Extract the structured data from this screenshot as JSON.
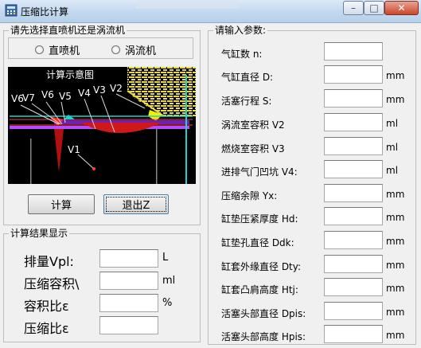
{
  "window": {
    "title": "压缩比计算"
  },
  "engine_type": {
    "group_label": "请先选择直喷机还是涡流机",
    "options": [
      "直喷机",
      "涡流机"
    ]
  },
  "diagram": {
    "title": "计算示意图",
    "labels": [
      "V6",
      "V7",
      "V6",
      "V5",
      "V4",
      "V3",
      "V2",
      "V1"
    ]
  },
  "buttons": {
    "calculate": "计算",
    "exit": "退出Z"
  },
  "results": {
    "group_label": "计算结果显示",
    "rows": [
      {
        "label": "排量Vpl:",
        "unit": "L"
      },
      {
        "label": "压缩容积\\",
        "unit": "ml"
      },
      {
        "label": "容积比ε",
        "unit": "%"
      },
      {
        "label": "压缩比ε",
        "unit": ""
      }
    ]
  },
  "params": {
    "group_label": "请输入参数:",
    "rows": [
      {
        "label": "气缸数 n:",
        "unit": ""
      },
      {
        "label": "气缸直径 D:",
        "unit": "mm"
      },
      {
        "label": "活塞行程 S:",
        "unit": "mm"
      },
      {
        "label": "涡流室容积 V2",
        "unit": "ml"
      },
      {
        "label": "燃烧室容积 V3",
        "unit": "ml"
      },
      {
        "label": "进排气门凹坑 V4:",
        "unit": "ml"
      },
      {
        "label": "压缩余隙 Yx:",
        "unit": "mm"
      },
      {
        "label": "缸垫压紧厚度 Hd:",
        "unit": "mm"
      },
      {
        "label": "缸垫孔直径 Ddk:",
        "unit": "mm"
      },
      {
        "label": "缸套外缘直径 Dty:",
        "unit": "mm"
      },
      {
        "label": "缸套凸肩高度 Htj:",
        "unit": "mm"
      },
      {
        "label": "活塞头部直径 Dpis:",
        "unit": "mm"
      },
      {
        "label": "活塞头部高度 Hpis:",
        "unit": "mm"
      }
    ]
  }
}
